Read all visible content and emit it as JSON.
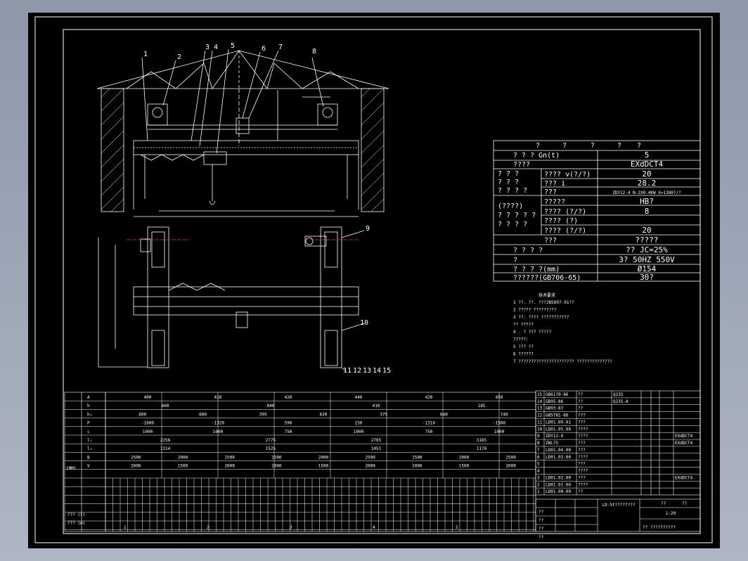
{
  "part_labels": [
    "1",
    "2",
    "3",
    "4",
    "5",
    "6",
    "7",
    "8",
    "9",
    "10",
    "11",
    "12",
    "13",
    "14",
    "15"
  ],
  "spec_table": {
    "header": [
      "?",
      "?",
      "?",
      "?",
      "?"
    ],
    "rows": [
      {
        "label": "? ? ? Gn(t)",
        "value": "5"
      },
      {
        "label": "????",
        "value": "EXdDCT4"
      },
      {
        "label": "????  v(?/?)",
        "value": "20"
      },
      {
        "label": "???  i",
        "value": "28.2"
      },
      {
        "label": "???",
        "value": "ZDY12-4 N-2X0.4KW X=1380?/?"
      },
      {
        "label": "?????",
        "value": "HB?"
      },
      {
        "label": "????  (?/?)",
        "value": "8"
      },
      {
        "label": "????  (?)",
        "value": ""
      },
      {
        "label": "????  (?/?)",
        "value": "20"
      },
      {
        "label": "???",
        "value": "?????"
      },
      {
        "label": "? ? ? ?",
        "value": "??  JC=25%"
      },
      {
        "label": "?",
        "value": "3?  50HZ  550V"
      },
      {
        "label": "? ? ? ?(mm)",
        "value": "Ø154"
      },
      {
        "label": "??????(GB706-65)",
        "value": "30?"
      }
    ],
    "left_groups": [
      {
        "lines": [
          "? ? ?",
          "? ? ?",
          "? ? ? ?"
        ]
      },
      {
        "lines": [
          "(????)",
          "? ? ? ? ?",
          "? ? ? ?"
        ]
      }
    ]
  },
  "notes": {
    "title": "技术要求",
    "lines": [
      "1 ??. ??. ???JB5897-91??",
      "2 ????? ?????????",
      "3 ??. ???? ???????????",
      "?? ?????",
      "4 . ? ??? ?????",
      "?????:",
      "5 ??? ??",
      "6 ??????",
      "7 ?????????????????????? ??????????????"
    ]
  },
  "dim_table": {
    "unit": "(MM)",
    "rows": [
      {
        "sym": "A",
        "vals": [
          "400",
          "410",
          "420",
          "440",
          "420",
          "450"
        ]
      },
      {
        "sym": "h",
        "vals": [
          "660",
          "840",
          "410",
          "185"
        ]
      },
      {
        "sym": "h₂",
        "vals": [
          "600",
          "600",
          "395",
          "620",
          "375",
          "640",
          "740"
        ]
      },
      {
        "sym": "P",
        "vals": [
          "-1600",
          "-1320",
          "590",
          "150",
          "-1310",
          "-1500"
        ]
      },
      {
        "sym": "c",
        "vals": [
          "1000",
          "1000",
          "750",
          "1000",
          "750",
          "1000"
        ]
      },
      {
        "sym": "l₁",
        "vals": [
          "2256",
          "2775",
          "2765",
          "3185"
        ]
      },
      {
        "sym": "l₂",
        "vals": [
          "1314",
          "1525",
          "1051",
          "1170"
        ]
      },
      {
        "sym": "B",
        "vals": [
          "2500",
          "2000",
          "2500",
          "1500",
          "2000",
          "2500",
          "1500",
          "2000",
          "2500"
        ]
      },
      {
        "sym": "V",
        "vals": [
          "2000",
          "1500",
          "2000",
          "1000",
          "1500",
          "2000",
          "1000",
          "1500",
          "2000"
        ]
      }
    ],
    "bottom_labels": [
      "??? (t)",
      "??? (m)"
    ],
    "bottom_numbers": [
      "1",
      "2",
      "3",
      "4",
      "5"
    ]
  },
  "parts_list": [
    {
      "no": "15",
      "code": "GB6170-86",
      "name": "??"
    },
    {
      "no": "14",
      "code": "GB95-86",
      "name": "??"
    },
    {
      "no": "13",
      "code": "GB93-87",
      "name": "??"
    },
    {
      "no": "12",
      "code": "GB5781-86",
      "name": "???"
    },
    {
      "no": "11",
      "code": "LD01.09.01",
      "name": "???"
    },
    {
      "no": "10",
      "code": "LD01.05.00",
      "name": "????"
    },
    {
      "no": "9",
      "code": "ZDY12-4",
      "name": "????"
    },
    {
      "no": "8",
      "code": "ZWL75",
      "name": "???"
    },
    {
      "no": "7",
      "code": "LD01.04.00",
      "name": "???"
    },
    {
      "no": "6",
      "code": "LD01.03.00",
      "name": "????"
    },
    {
      "no": "5",
      "code": "",
      "name": "???"
    },
    {
      "no": "4",
      "code": "",
      "name": "????"
    },
    {
      "no": "3",
      "code": "LD01.02.00",
      "name": "???"
    },
    {
      "no": "2",
      "code": "LD01.01.00",
      "name": "????"
    },
    {
      "no": "1",
      "code": "LD01.00.00",
      "name": "??"
    }
  ],
  "parts_extra": {
    "materials": [
      "Q235",
      "Q235-A",
      "",
      "",
      "",
      "",
      "",
      "",
      "",
      "",
      "",
      "",
      "",
      "",
      ""
    ],
    "right_codes": [
      "",
      "",
      "",
      "",
      "",
      "",
      "EXdDCT4",
      "EXdDCT4",
      "",
      "",
      "",
      "",
      "EXdDCT4",
      "",
      ""
    ]
  },
  "title_block": {
    "main_title": "LD-5t????????",
    "scale_label": "1:20",
    "header_labels": [
      "??",
      "??"
    ],
    "sub_labels": [
      "??",
      "??",
      "??",
      "??"
    ],
    "company": "??  ??????????"
  }
}
